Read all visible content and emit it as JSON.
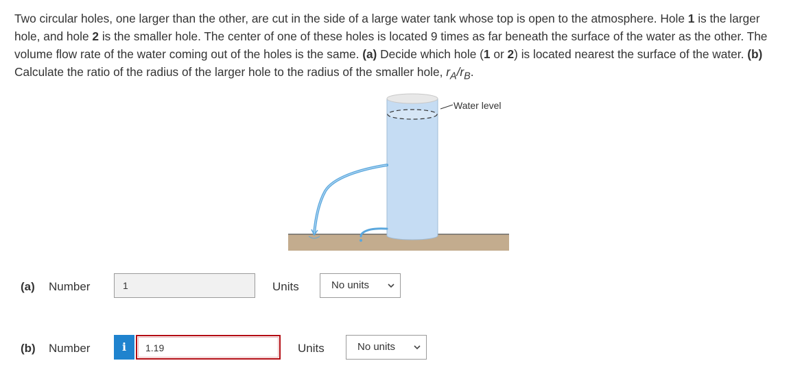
{
  "question": {
    "text_1": "Two circular holes, one larger than the other, are cut in the side of a large water tank whose top is open to the atmosphere. Hole ",
    "hole1": "1",
    "text_2": " is the larger hole, and hole ",
    "hole2": "2",
    "text_3": " is the smaller hole. The center of one of these holes is located 9 times as far beneath the surface of the water as the other. The volume flow rate of the water coming out of the holes is the same. ",
    "part_a": "(a)",
    "text_4": " Decide which hole (",
    "opt1": "1",
    "or": " or ",
    "opt2": "2",
    "text_5": ") is located nearest the surface of the water. ",
    "part_b": "(b)",
    "text_6": " Calculate the ratio of the radius of the larger hole to the radius of the smaller hole, ",
    "ratio_r1": "r",
    "ratio_a": "A",
    "ratio_slash": "/",
    "ratio_r2": "r",
    "ratio_b": "B",
    "text_end": "."
  },
  "figure": {
    "water_level_label": "Water level",
    "colors": {
      "water": "#c5dcf3",
      "stream": "#5aa7dd",
      "ground": "#b89e7a",
      "tank_top": "#e6e6e6"
    }
  },
  "answers": [
    {
      "part": "(a)",
      "field_label": "Number",
      "value": "1",
      "units_label": "Units",
      "units_selected": "No units"
    },
    {
      "part": "(b)",
      "field_label": "Number",
      "info_badge": "i",
      "value": "1.19",
      "units_label": "Units",
      "units_selected": "No units"
    }
  ]
}
